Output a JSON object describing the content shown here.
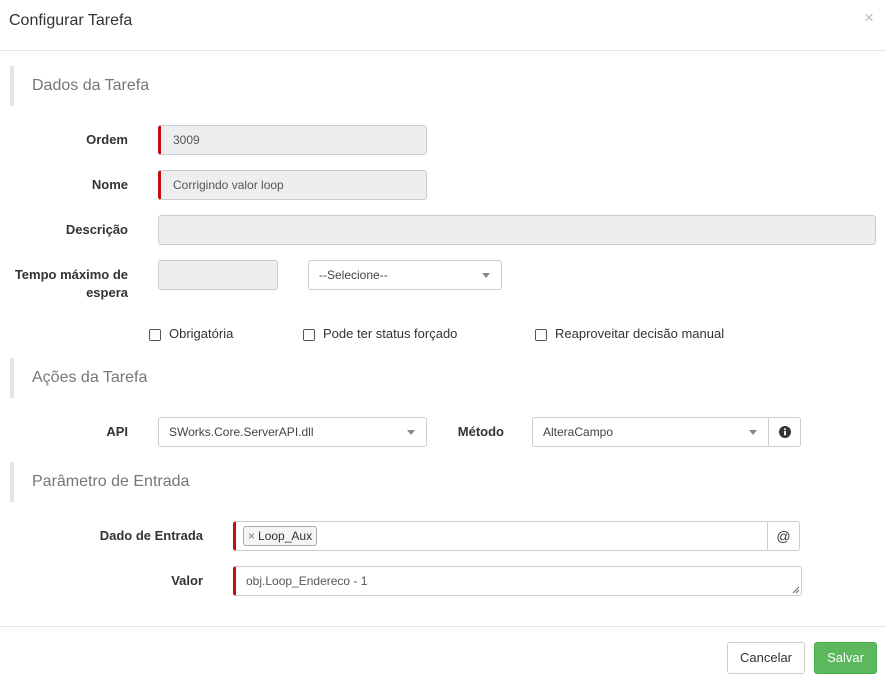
{
  "modal": {
    "title": "Configurar Tarefa",
    "close": "×"
  },
  "sections": {
    "dados": "Dados da Tarefa",
    "acoes": "Ações da Tarefa",
    "parametro": "Parâmetro de Entrada"
  },
  "form": {
    "ordem_label": "Ordem",
    "ordem_value": "3009",
    "nome_label": "Nome",
    "nome_value": "Corrigindo valor loop",
    "descricao_label": "Descrição",
    "descricao_value": "",
    "tempo_label_line1": "Tempo máximo de",
    "tempo_label_line2": "espera",
    "tempo_value": "",
    "tempo_unit_selected": "--Selecione--",
    "checkboxes": {
      "obrigatoria": "Obrigatória",
      "status_forcado": "Pode ter status forçado",
      "reaproveitar": "Reaproveitar decisão manual"
    }
  },
  "acoes": {
    "api_label": "API",
    "api_selected": "SWorks.Core.ServerAPI.dll",
    "metodo_label": "Método",
    "metodo_selected": "AlteraCampo"
  },
  "parametro": {
    "dado_label": "Dado de Entrada",
    "tag_remove": "×",
    "tag_value": "Loop_Aux",
    "at_symbol": "@",
    "valor_label": "Valor",
    "valor_value": "obj.Loop_Endereco - 1"
  },
  "footer": {
    "cancel": "Cancelar",
    "save": "Salvar"
  }
}
